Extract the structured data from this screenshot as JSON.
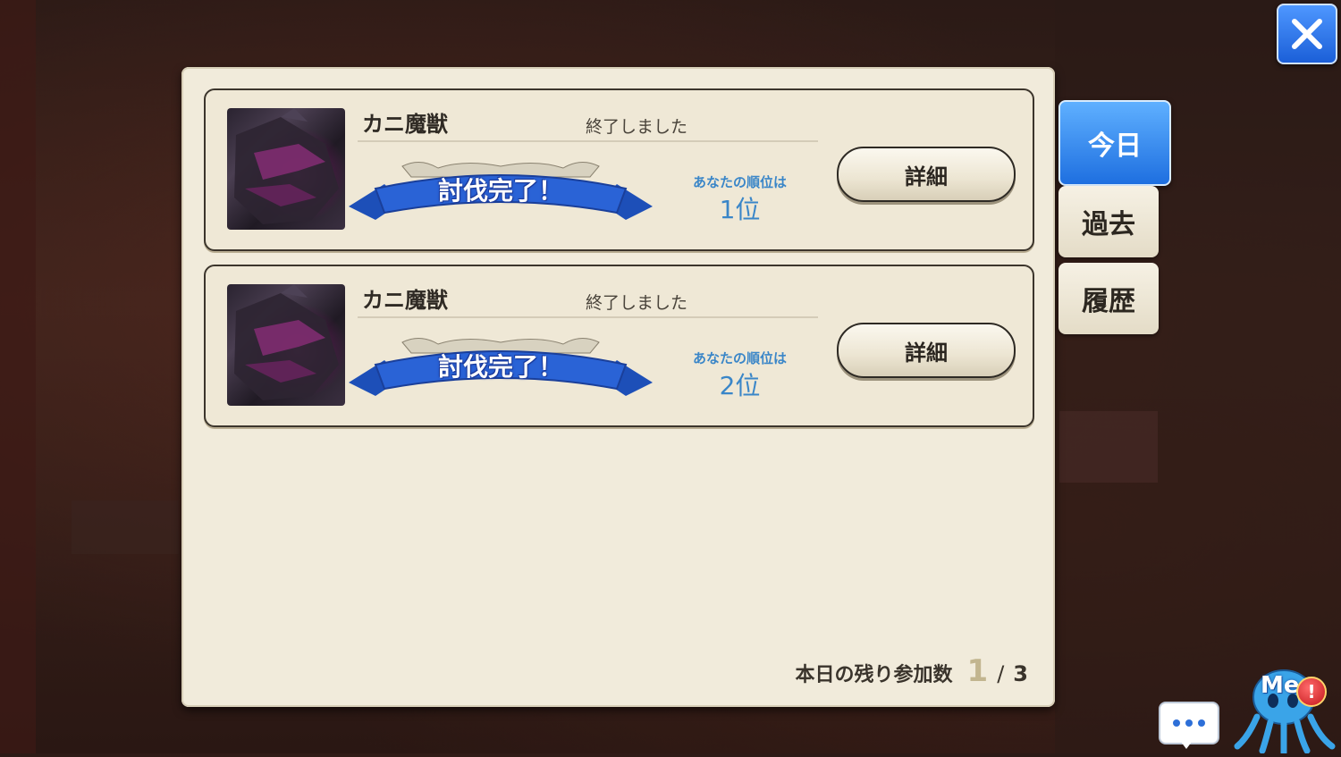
{
  "close_button": {
    "icon": "close-icon"
  },
  "raids": [
    {
      "monster_name": "カニ魔獣",
      "status": "終了しました",
      "ribbon_text": "討伐完了！",
      "rank_label": "あなたの順位は",
      "rank_value": "1位",
      "detail_label": "詳細"
    },
    {
      "monster_name": "カニ魔獣",
      "status": "終了しました",
      "ribbon_text": "討伐完了！",
      "rank_label": "あなたの順位は",
      "rank_value": "2位",
      "detail_label": "詳細"
    }
  ],
  "remaining": {
    "label": "本日の残り参加数",
    "current": "1",
    "separator": "/",
    "total": "3"
  },
  "tabs": [
    {
      "label": "今日",
      "active": true
    },
    {
      "label": "過去",
      "active": false
    },
    {
      "label": "履歴",
      "active": false
    }
  ],
  "chat_button": {
    "icon": "chat-bubble-icon"
  },
  "mascot": {
    "label": "Me",
    "badge": "!"
  },
  "colors": {
    "accent_blue": "#1e6fe0",
    "rank_blue": "#3a86c8",
    "panel_bg": "#f1ebdb"
  }
}
